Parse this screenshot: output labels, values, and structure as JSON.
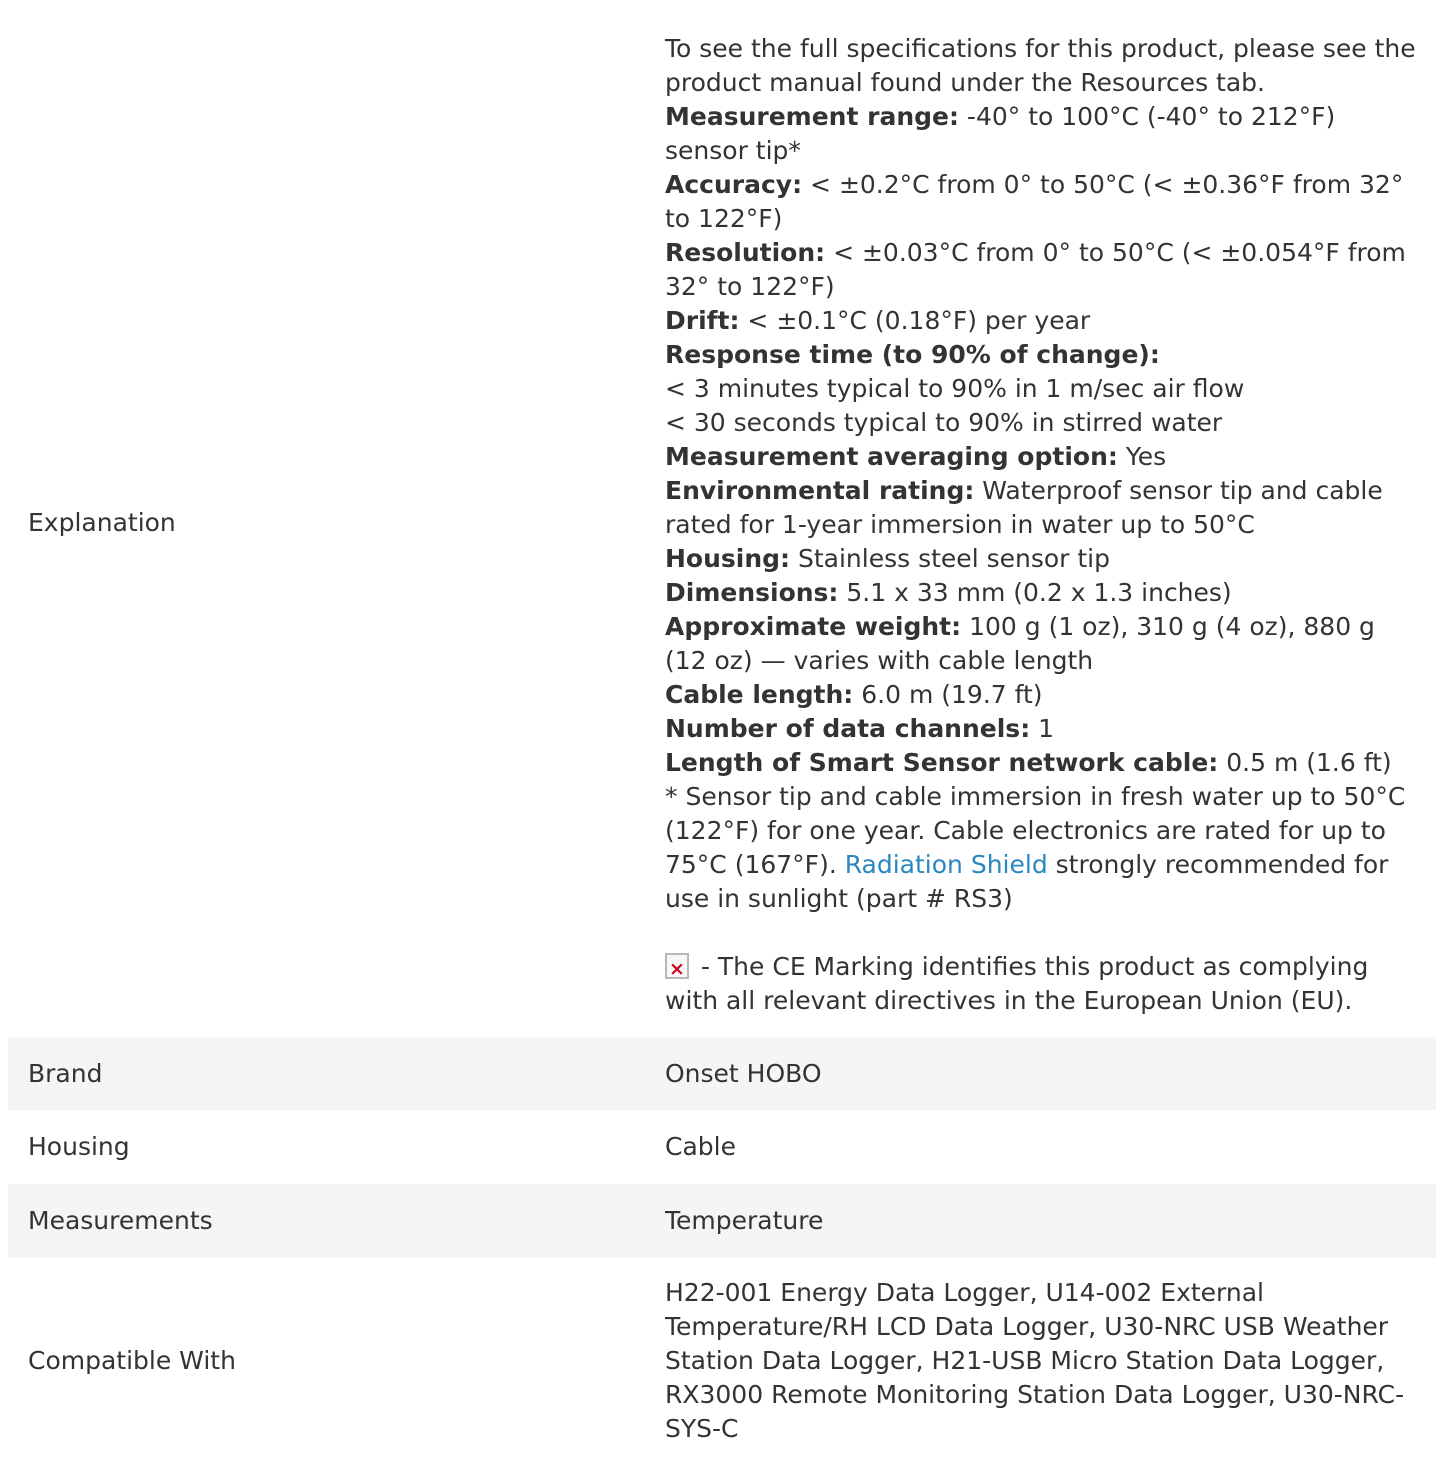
{
  "rows": {
    "explanation": {
      "label": "Explanation",
      "intro": "To see the full specifications for this product, please see the product manual found under the Resources tab.",
      "measurement_range": {
        "label": "Measurement range:",
        "value": " -40° to 100°C (-40° to 212°F) sensor tip*"
      },
      "accuracy": {
        "label": "Accuracy:",
        "value": " < ±0.2°C from 0° to 50°C (< ±0.36°F from 32° to 122°F)"
      },
      "resolution": {
        "label": "Resolution:",
        "value": " < ±0.03°C from 0° to 50°C (< ±0.054°F from 32° to 122°F)"
      },
      "drift": {
        "label": "Drift:",
        "value": " < ±0.1°C (0.18°F) per year"
      },
      "response_time": {
        "label": "Response time (to 90% of change):",
        "line1": "< 3 minutes typical to 90% in 1 m/sec air flow",
        "line2": "< 30 seconds typical to 90% in stirred water"
      },
      "averaging": {
        "label": "Measurement averaging option:",
        "value": " Yes"
      },
      "environmental": {
        "label": "Environmental rating:",
        "value": " Waterproof sensor tip and cable rated for 1-year immersion in water up to 50°C"
      },
      "housing": {
        "label": "Housing:",
        "value": " Stainless steel sensor tip"
      },
      "dimensions": {
        "label": "Dimensions:",
        "value": " 5.1 x 33 mm (0.2 x 1.3 inches)"
      },
      "weight": {
        "label": "Approximate weight:",
        "value": " 100 g (1 oz), 310 g (4 oz), 880 g (12 oz) — varies with cable length"
      },
      "cable_length": {
        "label": "Cable length:",
        "value": " 6.0 m (19.7 ft)"
      },
      "channels": {
        "label": "Number of data channels:",
        "value": " 1"
      },
      "network_cable": {
        "label": "Length of Smart Sensor network cable:",
        "value": " 0.5 m (1.6 ft)"
      },
      "footnote": {
        "before": "* Sensor tip and cable immersion in fresh water up to 50°C (122°F) for one year. Cable electronics are rated for up to 75°C (167°F). ",
        "link": "Radiation Shield",
        "after": " strongly recommended for use in sunlight (part # RS3)"
      },
      "ce": {
        "icon": "broken-image-icon",
        "text": " - The CE Marking identifies this product as complying with all relevant directives in the European Union (EU)."
      }
    },
    "brand": {
      "label": "Brand",
      "value": "Onset HOBO"
    },
    "housing": {
      "label": "Housing",
      "value": "Cable"
    },
    "measurements": {
      "label": "Measurements",
      "value": "Temperature"
    },
    "compatible": {
      "label": "Compatible With",
      "value": "H22-001 Energy Data Logger, U14-002 External Temperature/RH LCD Data Logger, U30-NRC USB Weather Station Data Logger, H21-USB Micro Station Data Logger, RX3000 Remote Monitoring Station Data Logger, U30-NRC-SYS-C"
    }
  },
  "colors": {
    "text": "#333333",
    "link": "#2a87c0",
    "row_shade": "#f5f5f5",
    "icon_x": "#d0021b"
  }
}
